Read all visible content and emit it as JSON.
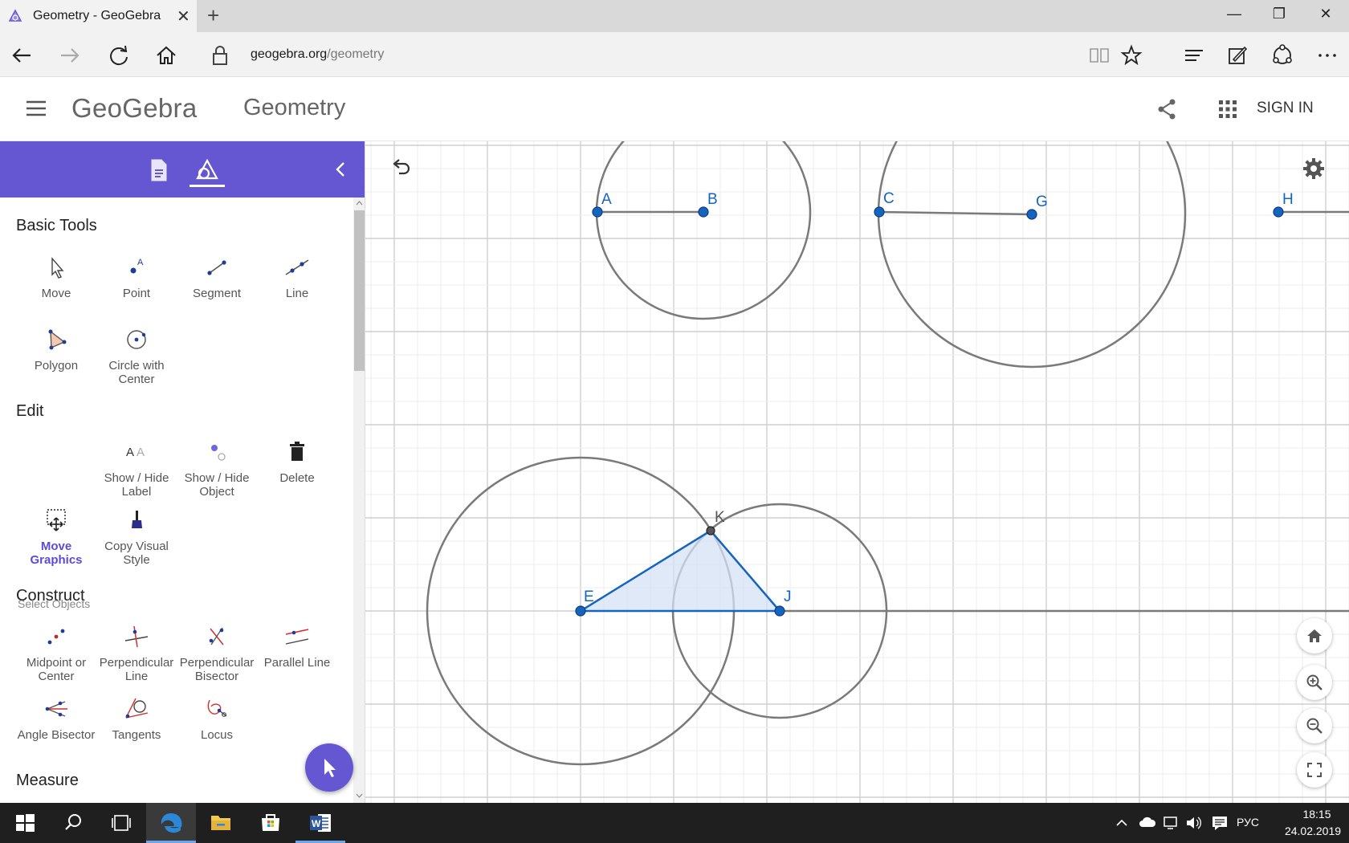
{
  "browser": {
    "tab_title": "Geometry - GeoGebra",
    "url_host": "geogebra.org",
    "url_path": "/geometry"
  },
  "header": {
    "logo": "GeoGebra",
    "app_name": "Geometry",
    "signin_label": "SIGN IN"
  },
  "panel": {
    "sections": {
      "basic": "Basic Tools",
      "edit": "Edit",
      "construct": "Construct",
      "measure": "Measure"
    },
    "hint": "Select Objects",
    "basic_tools": [
      "Move",
      "Point",
      "Segment",
      "Line",
      "Polygon",
      "Circle with Center"
    ],
    "edit_tools": [
      "Show / Hide Label",
      "Show / Hide Object",
      "Delete",
      "Move Graphics",
      "Copy Visual Style"
    ],
    "construct_tools": [
      "Midpoint or Center",
      "Perpendicular Line",
      "Perpendicular Bisector",
      "Parallel Line",
      "Angle Bisector",
      "Tangents",
      "Locus"
    ],
    "selected_tool": "Move Graphics"
  },
  "graphics": {
    "points": [
      "A",
      "B",
      "C",
      "G",
      "H",
      "E",
      "J",
      "K"
    ]
  },
  "taskbar": {
    "time": "18:15",
    "date": "24.02.2019",
    "language": "РУС"
  },
  "colors": {
    "accent": "#6557d2",
    "point_blue": "#1565c0",
    "shape_gray": "#707070",
    "polygon_fill": "#d6e2f5"
  }
}
